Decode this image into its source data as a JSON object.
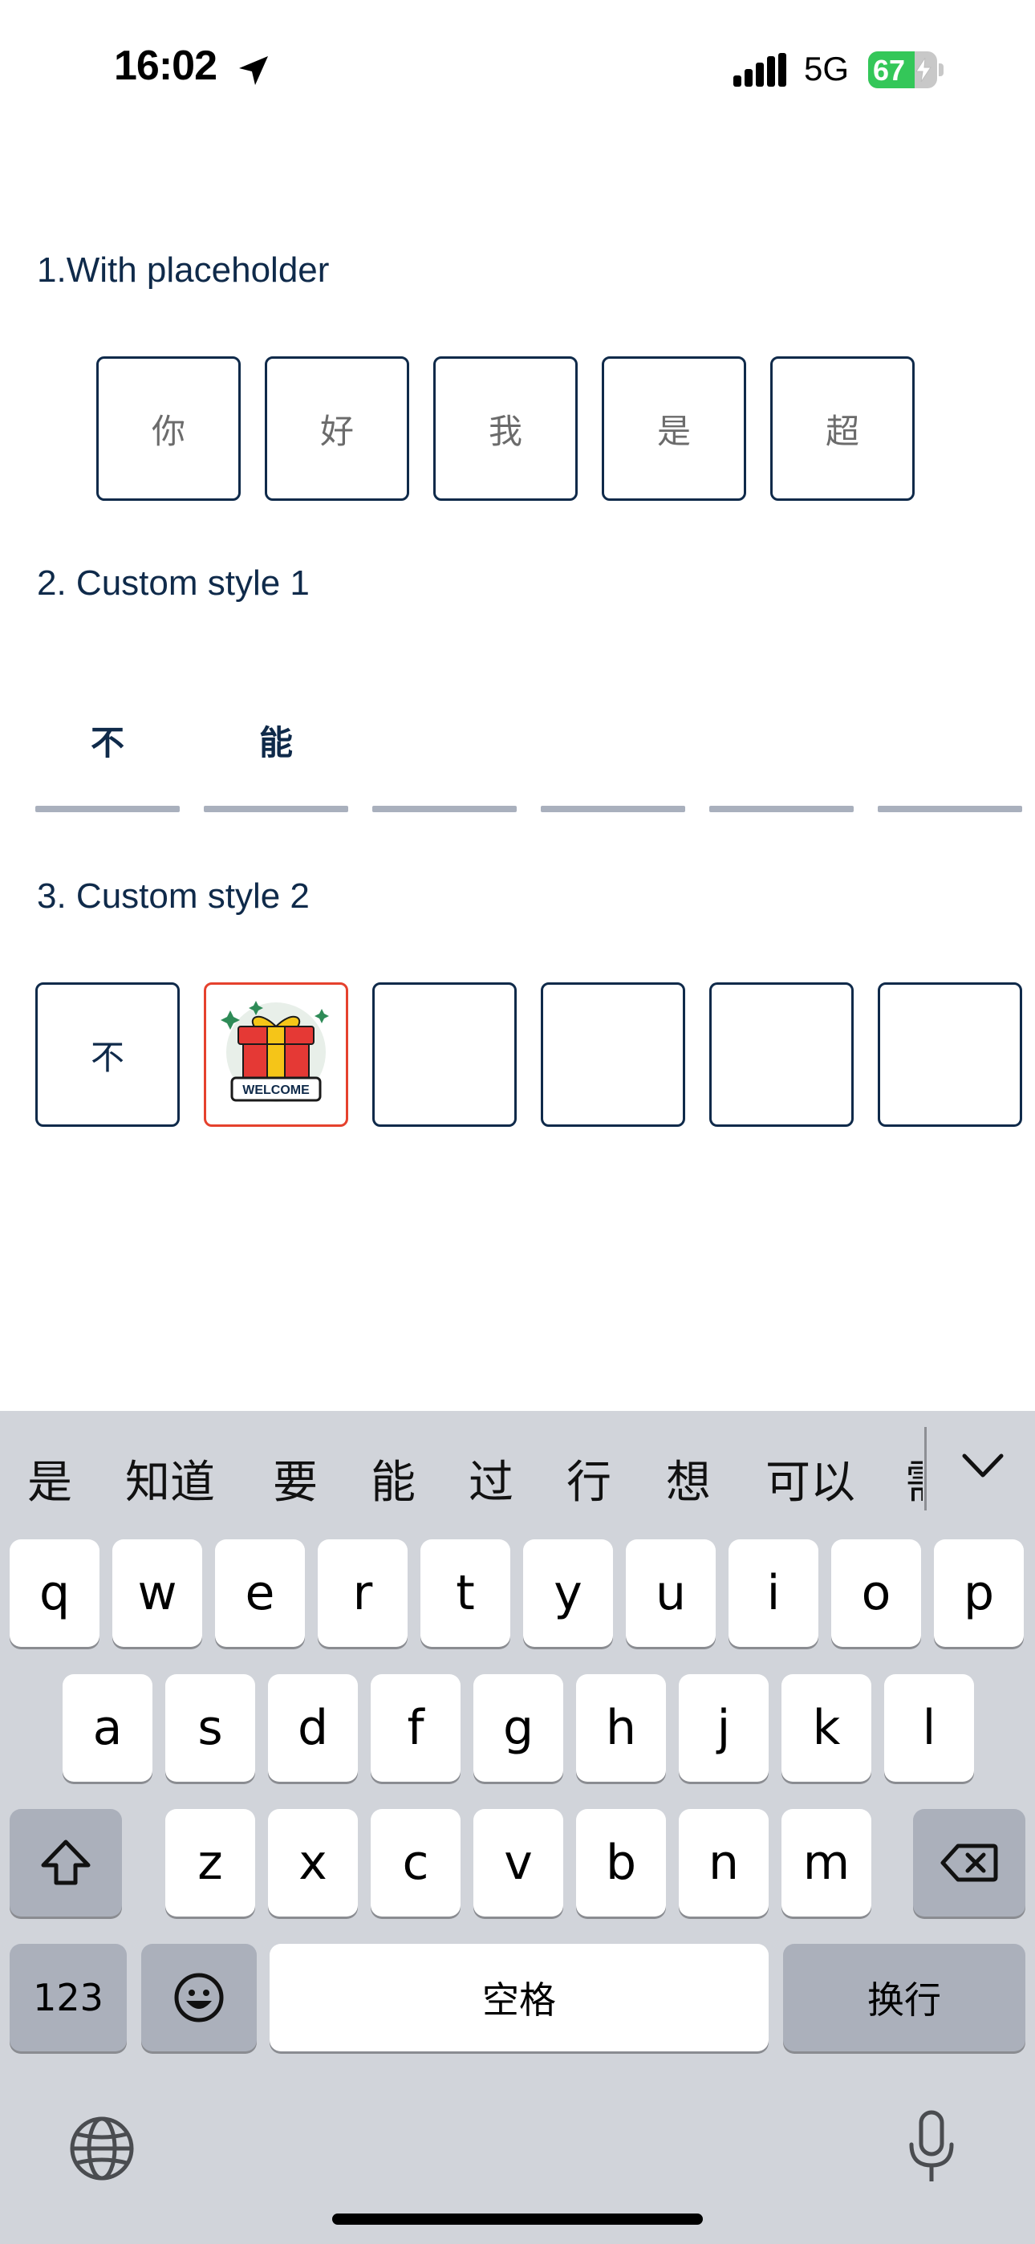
{
  "status_bar": {
    "time": "16:02",
    "network": "5G",
    "battery_level": "67",
    "battery_fraction": 0.67,
    "battery_color": "#34c759"
  },
  "sections": [
    {
      "title": "1.With placeholder",
      "placeholders": [
        "你",
        "好",
        "我",
        "是",
        "超"
      ]
    },
    {
      "title": "2. Custom style 1",
      "values": [
        "不",
        "能",
        "",
        "",
        "",
        ""
      ]
    },
    {
      "title": "3. Custom style 2",
      "values": [
        "不",
        "",
        "",
        "",
        "",
        ""
      ],
      "active_index": 1,
      "active_color": "#e5412d",
      "badge_text": "WELCOME"
    }
  ],
  "keyboard": {
    "candidates": [
      "是",
      "知道",
      "要",
      "能",
      "过",
      "行",
      "想",
      "可以",
      "需"
    ],
    "row1": [
      "q",
      "w",
      "e",
      "r",
      "t",
      "y",
      "u",
      "i",
      "o",
      "p"
    ],
    "row2": [
      "a",
      "s",
      "d",
      "f",
      "g",
      "h",
      "j",
      "k",
      "l"
    ],
    "row3": [
      "z",
      "x",
      "c",
      "v",
      "b",
      "n",
      "m"
    ],
    "numbers_label": "123",
    "space_label": "空格",
    "return_label": "换行"
  },
  "icons": [
    "location-arrow-icon",
    "signal-icon",
    "battery-icon",
    "gift-icon",
    "chevron-down-icon",
    "shift-icon",
    "backspace-icon",
    "emoji-icon",
    "globe-icon",
    "mic-icon"
  ],
  "colors": {
    "accent": "#0f2a4a",
    "active_border": "#e5412d",
    "keyboard_bg": "#d1d4da"
  }
}
